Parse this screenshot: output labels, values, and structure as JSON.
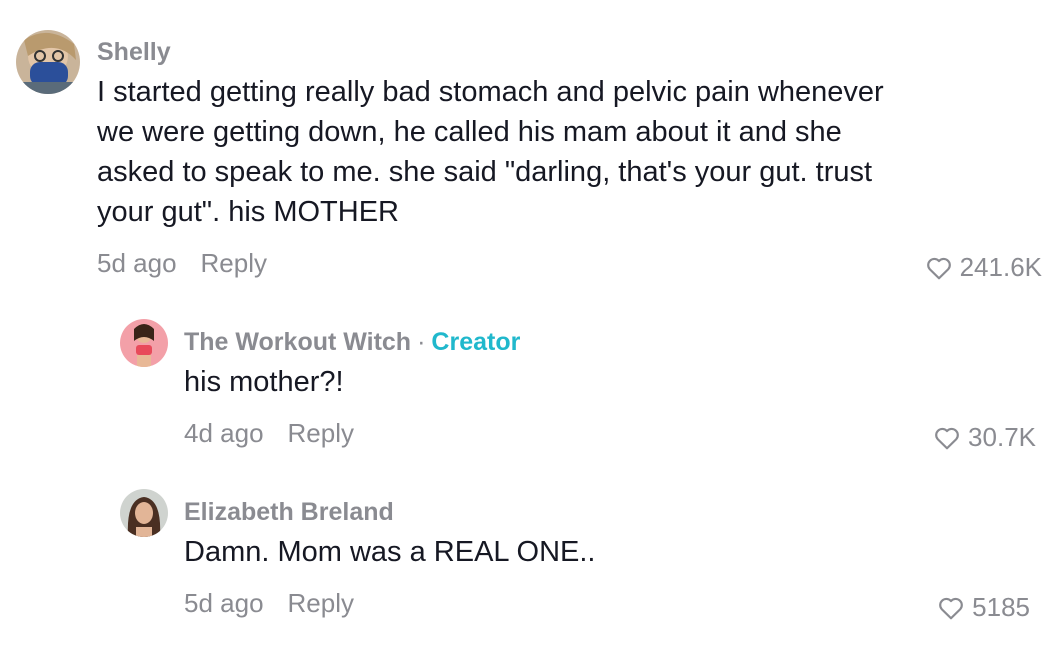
{
  "comments": [
    {
      "author": "Shelly",
      "text": "I started getting really bad stomach and pelvic pain whenever we were getting down, he called his mam about it and she asked to speak to me. she said \"darling, that's your gut. trust your gut\". his MOTHER",
      "time": "5d ago",
      "reply_label": "Reply",
      "likes": "241.6K"
    }
  ],
  "replies": [
    {
      "author": "The Workout Witch",
      "separator": "·",
      "badge": "Creator",
      "text": "his mother?!",
      "time": "4d ago",
      "reply_label": "Reply",
      "likes": "30.7K"
    },
    {
      "author": "Elizabeth Breland",
      "text": "Damn. Mom was a REAL ONE..",
      "time": "5d ago",
      "reply_label": "Reply",
      "likes": "5185"
    }
  ],
  "colors": {
    "author": "#8a8b91",
    "creator_badge": "#20b8cc",
    "text": "#161823",
    "meta": "#8a8b91"
  }
}
